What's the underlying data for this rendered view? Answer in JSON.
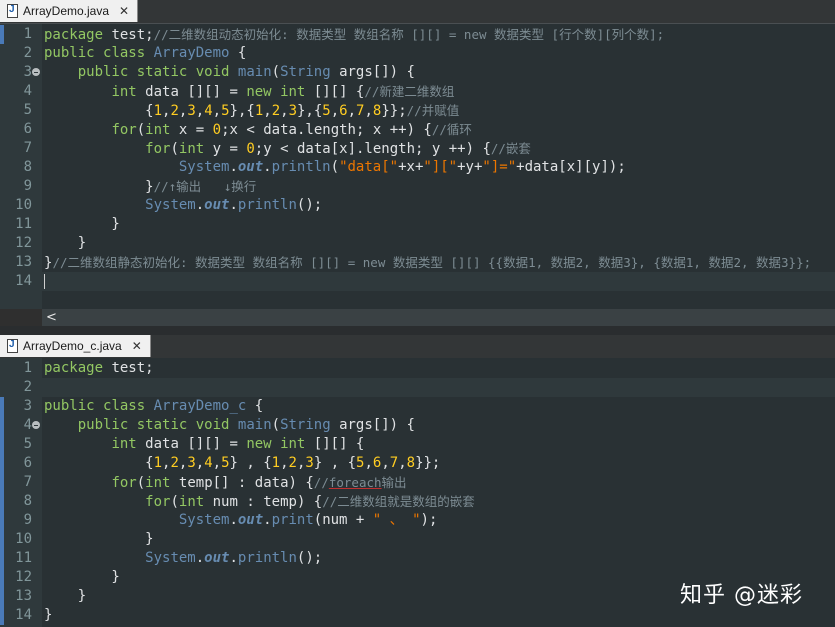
{
  "tab1": {
    "title": "ArrayDemo.java",
    "close": "✕"
  },
  "tab2": {
    "title": "ArrayDemo_c.java",
    "close": "✕"
  },
  "editor1": {
    "current_line": 14,
    "lines": [
      {
        "n": "1",
        "html": "<span class='k'>package</span> test;<span class='c'>//二维数组动态初始化: 数据类型 数组名称 [][] = new 数据类型 [行个数][列个数];</span>"
      },
      {
        "n": "2",
        "html": "<span class='k'>public</span> <span class='k'>class</span> <span class='t'>ArrayDemo</span> {"
      },
      {
        "n": "3",
        "fold": true,
        "html": "    <span class='k'>public</span> <span class='k'>static</span> <span class='k'>void</span> <span class='m'>main</span>(<span class='t'>String</span> <span class='v'>args</span>[]) {"
      },
      {
        "n": "4",
        "html": "        <span class='k'>int</span> <span class='v'>data</span> [][] = <span class='k'>new</span> <span class='k'>int</span> [][] {<span class='c'>//新建二维数组</span>"
      },
      {
        "n": "5",
        "html": "            {<span class='n'>1</span>,<span class='n'>2</span>,<span class='n'>3</span>,<span class='n'>4</span>,<span class='n'>5</span>},{<span class='n'>1</span>,<span class='n'>2</span>,<span class='n'>3</span>},{<span class='n'>5</span>,<span class='n'>6</span>,<span class='n'>7</span>,<span class='n'>8</span>}};<span class='c'>//并赋值</span>"
      },
      {
        "n": "6",
        "html": "        <span class='k'>for</span>(<span class='k'>int</span> <span class='v'>x</span> = <span class='n'>0</span>;<span class='v'>x</span> &lt; <span class='v'>data</span>.<span class='v'>length</span>; <span class='v'>x</span> ++) {<span class='c'>//循环</span>"
      },
      {
        "n": "7",
        "html": "            <span class='k'>for</span>(<span class='k'>int</span> <span class='v'>y</span> = <span class='n'>0</span>;<span class='v'>y</span> &lt; <span class='v'>data</span>[<span class='v'>x</span>].<span class='v'>length</span>; <span class='v'>y</span> ++) {<span class='c'>//嵌套</span>"
      },
      {
        "n": "8",
        "html": "                <span class='t'>System</span>.<span class='o'>out</span>.<span class='m'>println</span>(<span class='s'>\"data[\"</span>+<span class='v'>x</span>+<span class='s'>\"][\"</span>+<span class='v'>y</span>+<span class='s'>\"]=\"</span>+<span class='v'>data</span>[<span class='v'>x</span>][<span class='v'>y</span>]);"
      },
      {
        "n": "9",
        "html": "            }<span class='c'>//↑输出   ↓换行</span>"
      },
      {
        "n": "10",
        "html": "            <span class='t'>System</span>.<span class='o'>out</span>.<span class='m'>println</span>();"
      },
      {
        "n": "11",
        "html": "        }"
      },
      {
        "n": "12",
        "html": "    }"
      },
      {
        "n": "13",
        "html": "}<span class='c'>//二维数组静态初始化: 数据类型 数组名称 [][] = new 数据类型 [][] {{数据1, 数据2, 数据3}, {数据1, 数据2, 数据3}};</span>"
      },
      {
        "n": "14",
        "html": ""
      }
    ]
  },
  "editor2": {
    "current_line": 2,
    "lines": [
      {
        "n": "1",
        "html": "<span class='k'>package</span> test;"
      },
      {
        "n": "2",
        "html": ""
      },
      {
        "n": "3",
        "html": "<span class='k'>public</span> <span class='k'>class</span> <span class='t'>ArrayDemo_c</span> {"
      },
      {
        "n": "4",
        "fold": true,
        "html": "    <span class='k'>public</span> <span class='k'>static</span> <span class='k'>void</span> <span class='m'>main</span>(<span class='t'>String</span> <span class='v'>args</span>[]) {"
      },
      {
        "n": "5",
        "html": "        <span class='k'>int</span> <span class='v'>data</span> [][] = <span class='k'>new</span> <span class='k'>int</span> [][] {"
      },
      {
        "n": "6",
        "html": "            {<span class='n'>1</span>,<span class='n'>2</span>,<span class='n'>3</span>,<span class='n'>4</span>,<span class='n'>5</span>} , {<span class='n'>1</span>,<span class='n'>2</span>,<span class='n'>3</span>} , {<span class='n'>5</span>,<span class='n'>6</span>,<span class='n'>7</span>,<span class='n'>8</span>}};"
      },
      {
        "n": "7",
        "html": "        <span class='k'>for</span>(<span class='k'>int</span> <span class='v'>temp</span>[] : <span class='v'>data</span>) {<span class='c'>//<u>foreach</u>输出</span>"
      },
      {
        "n": "8",
        "html": "            <span class='k'>for</span>(<span class='k'>int</span> <span class='v'>num</span> : <span class='v'>temp</span>) {<span class='c'>//二维数组就是数组的嵌套</span>"
      },
      {
        "n": "9",
        "html": "                <span class='t'>System</span>.<span class='o'>out</span>.<span class='m'>print</span>(<span class='v'>num</span> + <span class='s'>\" 、 \"</span>);"
      },
      {
        "n": "10",
        "html": "            }"
      },
      {
        "n": "11",
        "html": "            <span class='t'>System</span>.<span class='o'>out</span>.<span class='m'>println</span>();"
      },
      {
        "n": "12",
        "html": "        }"
      },
      {
        "n": "13",
        "html": "    }"
      },
      {
        "n": "14",
        "html": "}"
      }
    ]
  },
  "watermark": "知乎 @迷彩",
  "hscroll_arrow": "<",
  "colors": {
    "keyword": "#93c763",
    "type": "#678cb1",
    "comment": "#7d8c93",
    "number": "#ffcd22",
    "string": "#ec7600",
    "field": "#678cb1",
    "text": "#e0e2e4"
  }
}
